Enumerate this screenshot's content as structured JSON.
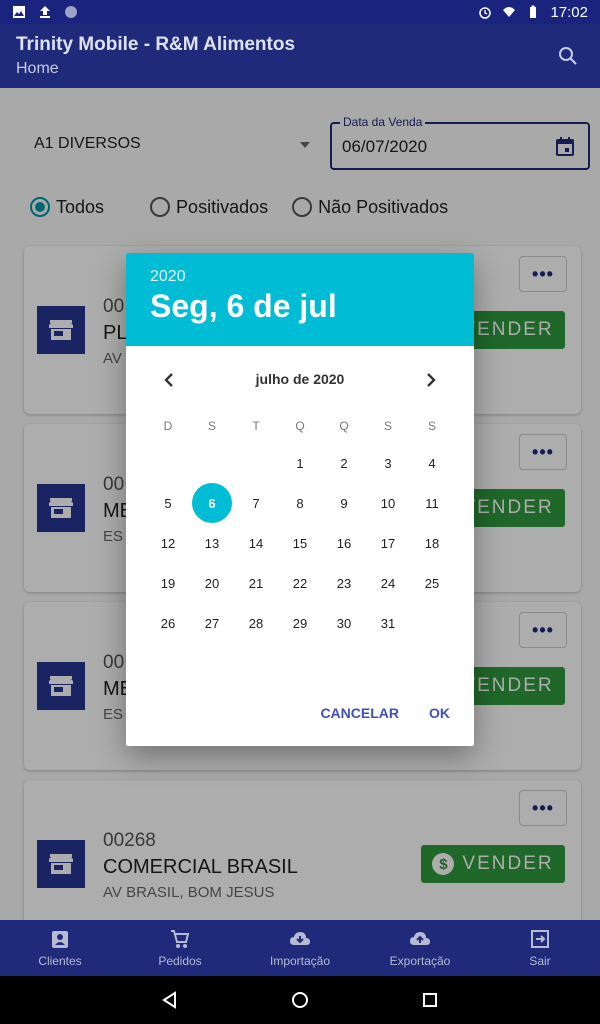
{
  "status_bar": {
    "time": "17:02",
    "icons": [
      "image-icon",
      "upload-icon",
      "sync-icon",
      "alarm-icon",
      "wifi-icon",
      "battery-icon"
    ]
  },
  "app_bar": {
    "title": "Trinity Mobile - R&M Alimentos",
    "subtitle": "Home",
    "icon": "search-icon"
  },
  "filters": {
    "category": "A1 DIVERSOS",
    "date_label": "Data da Venda",
    "date_value": "06/07/2020",
    "radios": [
      {
        "label": "Todos",
        "checked": true
      },
      {
        "label": "Positivados",
        "checked": false
      },
      {
        "label": "Não Positivados",
        "checked": false
      }
    ]
  },
  "cards": [
    {
      "code": "00",
      "name": "PL",
      "address": "AV",
      "more": "•••",
      "action": "VENDER"
    },
    {
      "code": "00",
      "name": "ME",
      "address": "ES",
      "more": "•••",
      "action": "VENDER"
    },
    {
      "code": "00",
      "name": "ME",
      "address": "ES",
      "more": "•••",
      "action": "VENDER"
    },
    {
      "code": "00268",
      "name": "COMERCIAL BRASIL",
      "address": "AV BRASIL, BOM JESUS",
      "more": "•••",
      "action": "VENDER"
    }
  ],
  "dialog": {
    "year": "2020",
    "selected_date": "Seg, 6 de jul",
    "month_label": "julho de 2020",
    "weekdays": [
      "D",
      "S",
      "T",
      "Q",
      "Q",
      "S",
      "S"
    ],
    "days": [
      "",
      "",
      "",
      "1",
      "2",
      "3",
      "4",
      "5",
      "6",
      "7",
      "8",
      "9",
      "10",
      "11",
      "12",
      "13",
      "14",
      "15",
      "16",
      "17",
      "18",
      "19",
      "20",
      "21",
      "22",
      "23",
      "24",
      "25",
      "26",
      "27",
      "28",
      "29",
      "30",
      "31"
    ],
    "selected_day": "6",
    "cancel": "CANCELAR",
    "ok": "OK",
    "accent": "#00bcd4"
  },
  "bottom_nav": [
    {
      "label": "Clientes",
      "icon": "contacts-icon"
    },
    {
      "label": "Pedidos",
      "icon": "cart-icon"
    },
    {
      "label": "Importação",
      "icon": "cloud-download-icon"
    },
    {
      "label": "Exportação",
      "icon": "cloud-upload-icon"
    },
    {
      "label": "Sair",
      "icon": "exit-icon"
    }
  ],
  "colors": {
    "primary": "#1f2a7a",
    "accent": "#00bcd4",
    "success": "#2e9a3e"
  }
}
